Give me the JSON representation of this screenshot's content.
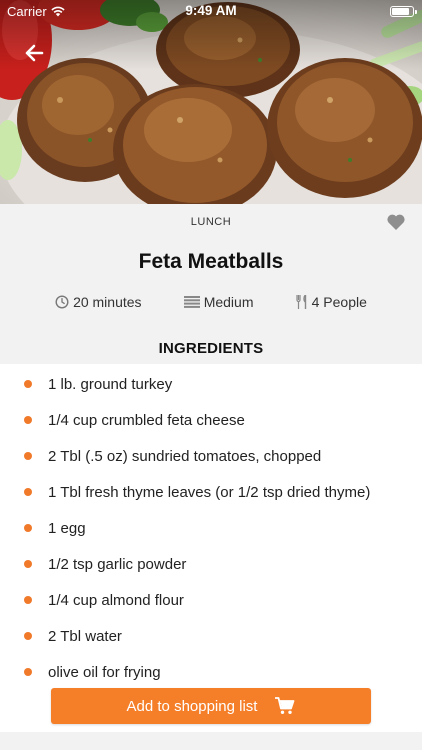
{
  "status_bar": {
    "carrier": "Carrier",
    "time": "9:49 AM"
  },
  "recipe": {
    "category": "LUNCH",
    "title": "Feta Meatballs",
    "time": "20 minutes",
    "difficulty": "Medium",
    "servings": "4 People"
  },
  "ingredients_heading": "INGREDIENTS",
  "ingredients": [
    "1 lb. ground turkey",
    "1/4 cup crumbled feta cheese",
    "2 Tbl (.5 oz) sundried tomatoes, chopped",
    "1 Tbl fresh thyme leaves (or 1/2 tsp dried thyme)",
    "1 egg",
    "1/2 tsp garlic powder",
    "1/4 cup almond flour",
    "2 Tbl water",
    "olive oil for frying"
  ],
  "cta": {
    "label": "Add to shopping list"
  },
  "icons": {
    "back": "arrow-left-icon",
    "favorite": "heart-icon",
    "time": "clock-icon",
    "difficulty": "difficulty-icon",
    "servings": "utensils-icon",
    "cart": "cart-icon",
    "wifi": "wifi-icon",
    "battery": "battery-icon"
  },
  "colors": {
    "accent": "#f57e29",
    "bullet": "#f07a2a",
    "background": "#f2f2f2"
  }
}
